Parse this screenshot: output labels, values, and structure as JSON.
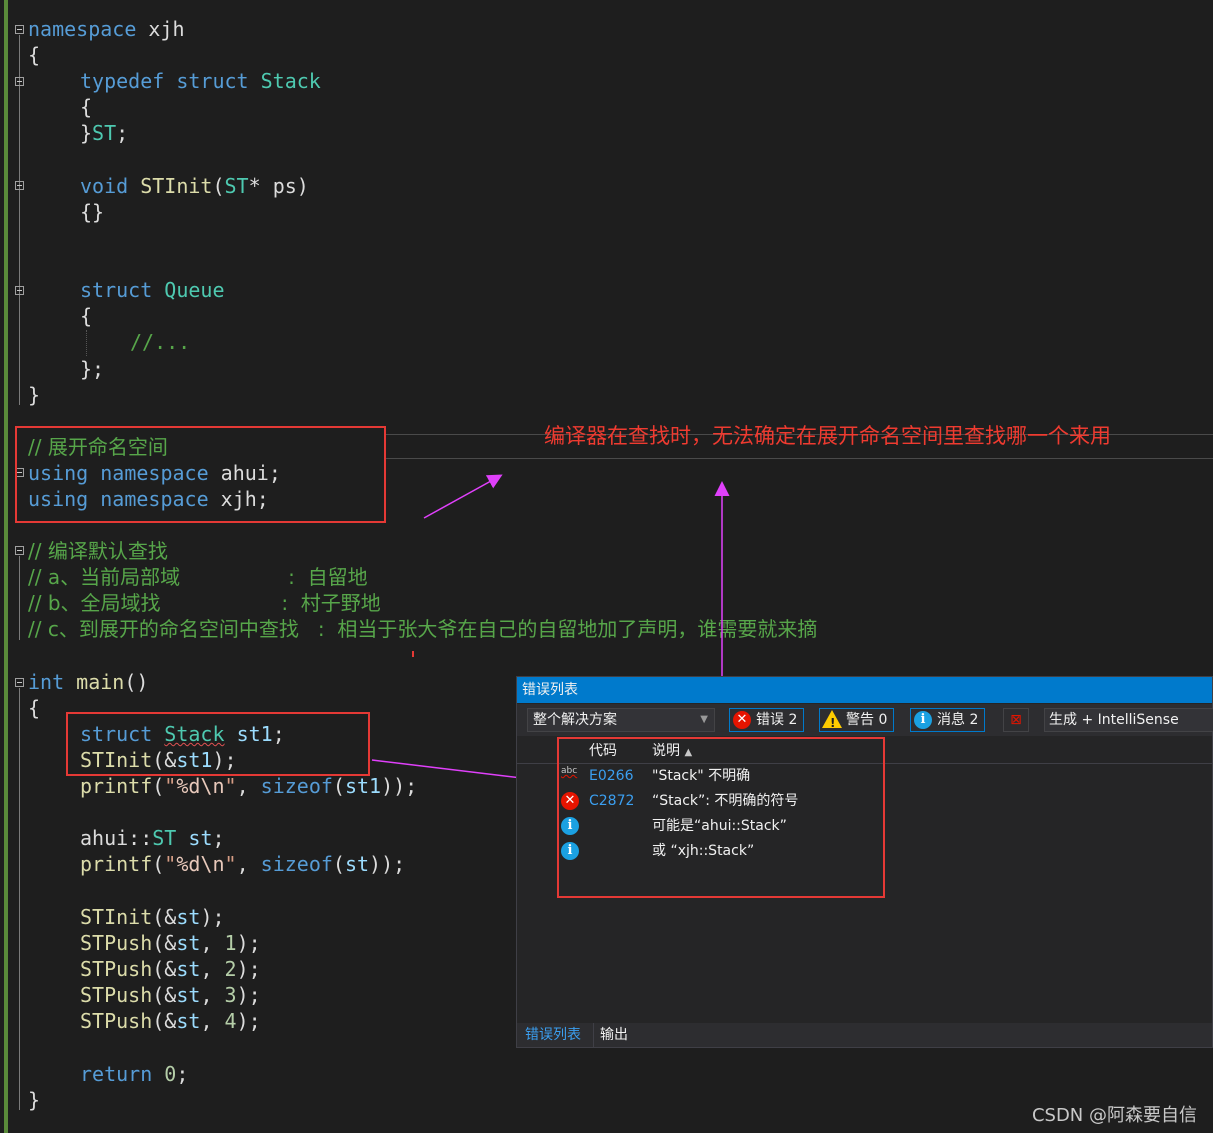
{
  "editor": {
    "lines": {
      "l1": {
        "kw": "namespace",
        "name": " xjh"
      },
      "l2": "{",
      "l3": {
        "kw": "typedef struct",
        "ty": "Stack"
      },
      "l4": "{",
      "l5": {
        "brace": "}",
        "ty": "ST",
        "semi": ";"
      },
      "l7": {
        "kw": "void",
        "fn": "STInit",
        "open": "(",
        "ty": "ST",
        "rest": "* ps)"
      },
      "l8": "{}",
      "l11": {
        "kw": "struct",
        "ty": "Queue"
      },
      "l12": "{",
      "l13": "//...",
      "l14": "};",
      "l15": "}",
      "l17": "// 展开命名空间",
      "l18": {
        "kw": "using namespace",
        "name": " ahui;"
      },
      "l19": {
        "kw": "using namespace",
        "name": " xjh;"
      },
      "l21": "// 编译默认查找",
      "l22": "// a、当前局部域                 :  自留地",
      "l23": "// b、全局域找                   :  村子野地",
      "l24": "// c、到展开的命名空间中查找   :  相当于张大爷在自己的自留地加了声明，谁需要就来摘",
      "l26": {
        "kw": "int",
        "fn": "main",
        "rest": "()"
      },
      "l27": "{",
      "l28": {
        "kw": "struct",
        "ty": "Stack",
        "var": "st1",
        "semi": ";"
      },
      "l29": {
        "fn": "STInit",
        "open": "(&",
        "var": "st1",
        "close": ");"
      },
      "l30": {
        "fn": "printf",
        "open": "(",
        "str1": "\"",
        "esc": "%d\\n",
        "str2": "\"",
        "mid": ", ",
        "kw": "sizeof",
        "open2": "(",
        "var": "st1",
        "close": "));"
      },
      "l32": {
        "ns": "ahui",
        "sep": "::",
        "ty": "ST",
        "var": "st",
        "semi": ";"
      },
      "l33": {
        "fn": "printf",
        "open": "(",
        "str1": "\"",
        "esc": "%d\\n",
        "str2": "\"",
        "mid": ", ",
        "kw": "sizeof",
        "open2": "(",
        "var": "st",
        "close": "));"
      },
      "l35": {
        "fn": "STInit",
        "open": "(&",
        "var": "st",
        "close": ");"
      },
      "l36": {
        "fn": "STPush",
        "open": "(&",
        "var": "st",
        "sep": ", ",
        "num": "1",
        "close": ");"
      },
      "l37": {
        "fn": "STPush",
        "open": "(&",
        "var": "st",
        "sep": ", ",
        "num": "2",
        "close": ");"
      },
      "l38": {
        "fn": "STPush",
        "open": "(&",
        "var": "st",
        "sep": ", ",
        "num": "3",
        "close": ");"
      },
      "l39": {
        "fn": "STPush",
        "open": "(&",
        "var": "st",
        "sep": ", ",
        "num": "4",
        "close": ");"
      },
      "l41": {
        "kw": "return",
        "num": " 0",
        "semi": ";"
      },
      "l42": "}"
    }
  },
  "annotation": "编译器在查找时，无法确定在展开命名空间里查找哪一个来用",
  "error_list": {
    "title": "错误列表",
    "scope": "整个解决方案",
    "errors_label": "错误 2",
    "warnings_label": "警告 0",
    "messages_label": "消息 2",
    "build_filter": "生成 + IntelliSense",
    "col_code": "代码",
    "col_desc": "说明",
    "sort_indicator": "▲",
    "rows": [
      {
        "icon": "intellisense",
        "code": "E0266",
        "desc": "\"Stack\" 不明确"
      },
      {
        "icon": "error",
        "code": "C2872",
        "desc": "“Stack”: 不明确的符号"
      },
      {
        "icon": "info",
        "code": "",
        "desc": "可能是“ahui::Stack”"
      },
      {
        "icon": "info",
        "code": "",
        "desc": "或   “xjh::Stack”"
      }
    ],
    "tabs": [
      "错误列表",
      "输出"
    ]
  },
  "watermark": "CSDN @阿森要自信",
  "colors": {
    "accent": "#007acc",
    "annotation_red": "#ef3b30",
    "arrow": "#e040fb",
    "error": "#e51400"
  }
}
